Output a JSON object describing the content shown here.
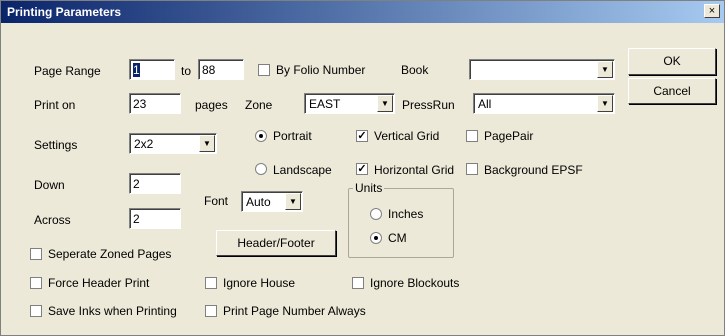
{
  "window": {
    "title": "Printing Parameters",
    "close_glyph": "×"
  },
  "page_range": {
    "label": "Page Range",
    "from": "1",
    "to_label": "to",
    "to": "88"
  },
  "by_folio": {
    "label": "By Folio Number",
    "checked": false
  },
  "book": {
    "label": "Book",
    "value": ""
  },
  "print_on": {
    "label": "Print on",
    "value": "23",
    "suffix": "pages"
  },
  "zone": {
    "label": "Zone",
    "value": "EAST"
  },
  "pressrun": {
    "label": "PressRun",
    "value": "All"
  },
  "settings": {
    "label": "Settings",
    "value": "2x2"
  },
  "orientation": {
    "portrait": "Portrait",
    "landscape": "Landscape",
    "selected": "portrait"
  },
  "vertical_grid": {
    "label": "Vertical Grid",
    "checked": true
  },
  "horizontal_grid": {
    "label": "Horizontal Grid",
    "checked": true
  },
  "page_pair": {
    "label": "PagePair",
    "checked": false
  },
  "background_epsf": {
    "label": "Background EPSF",
    "checked": false
  },
  "down": {
    "label": "Down",
    "value": "2"
  },
  "across": {
    "label": "Across",
    "value": "2"
  },
  "font": {
    "label": "Font",
    "value": "Auto"
  },
  "units": {
    "legend": "Units",
    "inches": "Inches",
    "cm": "CM",
    "selected": "cm"
  },
  "header_footer_button": "Header/Footer",
  "ok_button": "OK",
  "cancel_button": "Cancel",
  "seperate_zoned_pages": {
    "label": "Seperate Zoned Pages",
    "checked": false
  },
  "force_header_print": {
    "label": "Force Header Print",
    "checked": false
  },
  "ignore_house": {
    "label": "Ignore House",
    "checked": false
  },
  "ignore_blockouts": {
    "label": "Ignore Blockouts",
    "checked": false
  },
  "save_inks": {
    "label": "Save Inks when Printing",
    "checked": false
  },
  "print_page_number_always": {
    "label": "Print Page Number Always",
    "checked": false
  },
  "check_mark": "✓",
  "dropdown_arrow": "▼"
}
